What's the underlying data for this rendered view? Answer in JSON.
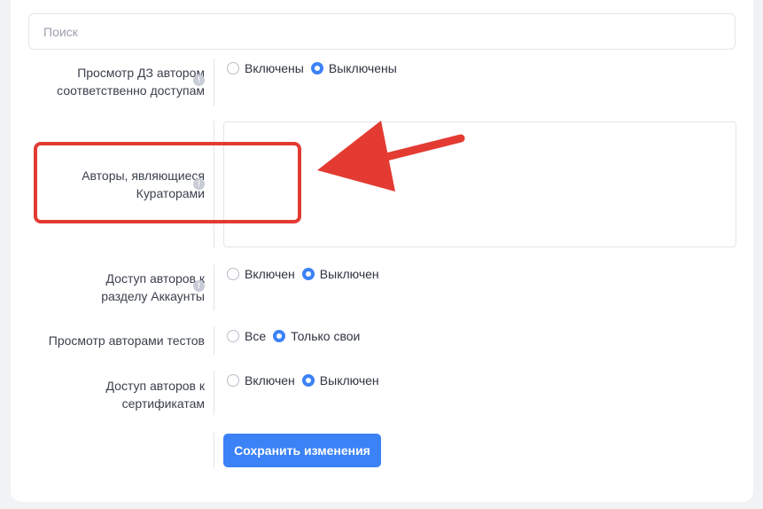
{
  "search": {
    "placeholder": "Поиск"
  },
  "settings": [
    {
      "label_line1": "Просмотр ДЗ автором",
      "label_line2": "соответственно доступам",
      "options": [
        "Включены",
        "Выключены"
      ],
      "selected": 1
    },
    {
      "label_line1": "Авторы, являющиеся",
      "label_line2": "Кураторами"
    },
    {
      "label_line1": "Доступ авторов к",
      "label_line2": "разделу Аккаунты",
      "options": [
        "Включен",
        "Выключен"
      ],
      "selected": 1
    },
    {
      "label_line1": "Просмотр авторами тестов",
      "options": [
        "Все",
        "Только свои"
      ],
      "selected": 1
    },
    {
      "label_line1": "Доступ авторов к",
      "label_line2": "сертификатам",
      "options": [
        "Включен",
        "Выключен"
      ],
      "selected": 1
    }
  ],
  "info_icon": "!",
  "save_button": {
    "label": "Сохранить изменения"
  },
  "annotation": {
    "color": "#e33b32"
  },
  "accent_color": "#3b82f6"
}
